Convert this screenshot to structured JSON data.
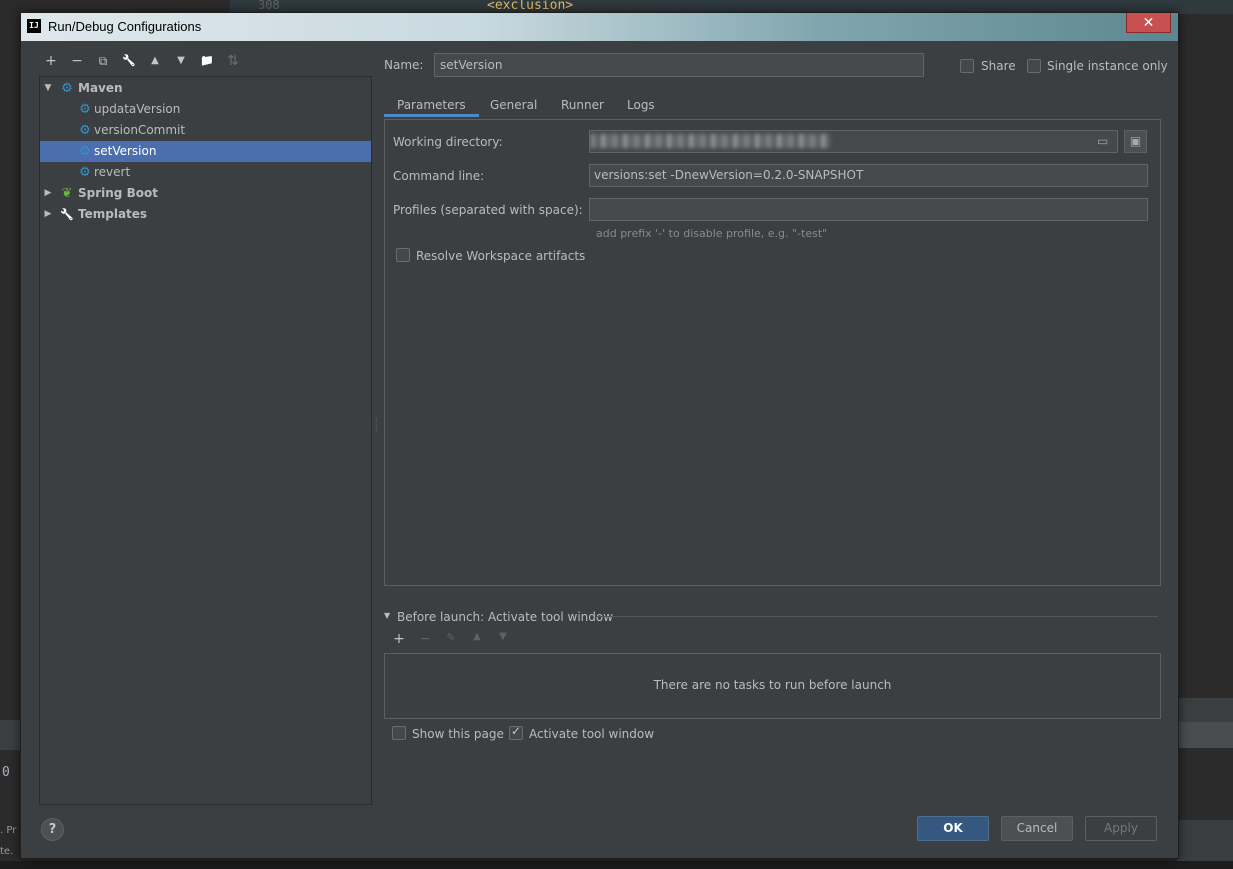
{
  "background": {
    "line_number": "308",
    "code_line": "<exclusion>",
    "left_digit": "0",
    "left_text_1": ". Pr",
    "left_text_2": "te."
  },
  "dialog": {
    "title": "Run/Debug Configurations",
    "app_icon_text": "IJ",
    "close_label": "✕"
  },
  "toolbar": {
    "add": "+",
    "remove": "−",
    "copy": "⧉",
    "edit": "🔧",
    "move_up": "▲",
    "move_down": "▼",
    "new_folder": "📁",
    "sort": "⇅"
  },
  "tree": {
    "items": [
      {
        "label": "Maven",
        "expanded": true,
        "icon": "maven-gear-icon"
      },
      {
        "label": "updataVersion",
        "icon": "maven-gear-icon"
      },
      {
        "label": "versionCommit",
        "icon": "maven-gear-icon"
      },
      {
        "label": "setVersion",
        "icon": "maven-gear-icon",
        "selected": true
      },
      {
        "label": "revert",
        "icon": "maven-gear-icon"
      },
      {
        "label": "Spring Boot",
        "expanded": false,
        "icon": "spring-boot-icon"
      },
      {
        "label": "Templates",
        "expanded": false,
        "icon": "wrench-icon"
      }
    ]
  },
  "config": {
    "name_label": "Name:",
    "name_value": "setVersion",
    "share_label": "Share",
    "single_instance_label": "Single instance only"
  },
  "tabs": [
    {
      "label": "Parameters",
      "active": true
    },
    {
      "label": "General"
    },
    {
      "label": "Runner"
    },
    {
      "label": "Logs"
    }
  ],
  "parameters": {
    "working_dir_label": "Working directory:",
    "command_line_label": "Command line:",
    "command_line_value": "versions:set -DnewVersion=0.2.0-SNAPSHOT",
    "profiles_label": "Profiles (separated with space):",
    "profiles_value": "",
    "profiles_hint": "add prefix '-' to disable profile, e.g. \"-test\"",
    "resolve_workspace_label": "Resolve Workspace artifacts"
  },
  "before_launch": {
    "title": "Before launch: Activate tool window",
    "empty_text": "There are no tasks to run before launch",
    "show_page_label": "Show this page",
    "activate_tool_window_label": "Activate tool window",
    "activate_checked": true
  },
  "buttons": {
    "help": "?",
    "ok": "OK",
    "cancel": "Cancel",
    "apply": "Apply"
  },
  "colors": {
    "selection": "#4b6eaf",
    "primary_button": "#365880",
    "dialog_bg": "#3c3f41"
  }
}
